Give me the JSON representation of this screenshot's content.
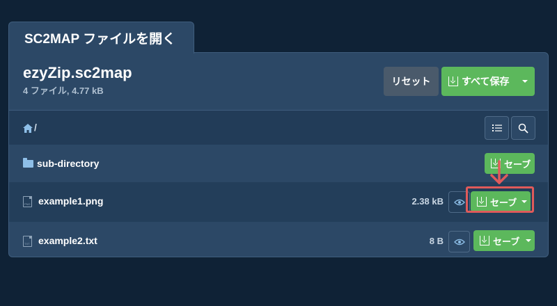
{
  "tab": {
    "title": "SC2MAP ファイルを開く"
  },
  "archive": {
    "name": "ezyZip.sc2map",
    "meta": "4 ファイル, 4.77 kB"
  },
  "toolbar": {
    "reset_label": "リセット",
    "save_all_label": "すべて保存"
  },
  "breadcrumb": {
    "separator": "/"
  },
  "rows": [
    {
      "name": "sub-directory",
      "type": "folder",
      "size": "",
      "save_label": "セーブ"
    },
    {
      "name": "example1.png",
      "type": "file",
      "ext": "PNG",
      "size": "2.38 kB",
      "save_label": "セーブ"
    },
    {
      "name": "example2.txt",
      "type": "file",
      "ext": "TXT",
      "size": "8 B",
      "save_label": "セーブ"
    }
  ],
  "colors": {
    "accent": "#5cb85c",
    "panel": "#2c4866",
    "background": "#0f2236",
    "highlight": "#e05a5a"
  }
}
